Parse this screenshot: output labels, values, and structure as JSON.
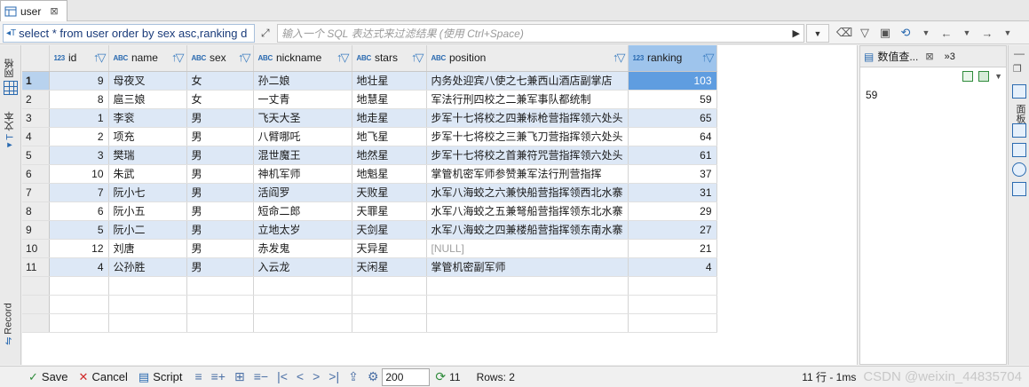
{
  "tab": {
    "title": "user",
    "close": "⊠"
  },
  "query": {
    "text": "select * from user order by sex asc,ranking d",
    "filter_placeholder": "输入一个 SQL 表达式来过滤结果 (使用 Ctrl+Space)"
  },
  "left_strip": {
    "grid_label": "网格",
    "text_label": "文本",
    "record_label": "Record"
  },
  "columns": [
    {
      "type": "123",
      "name": "id"
    },
    {
      "type": "ABC",
      "name": "name"
    },
    {
      "type": "ABC",
      "name": "sex"
    },
    {
      "type": "ABC",
      "name": "nickname"
    },
    {
      "type": "ABC",
      "name": "stars"
    },
    {
      "type": "ABC",
      "name": "position"
    },
    {
      "type": "123",
      "name": "ranking"
    }
  ],
  "rows": [
    {
      "n": "1",
      "id": "9",
      "name": "母夜叉",
      "sex": "女",
      "nickname": "孙二娘",
      "stars": "地壮星",
      "position": "内务处迎宾八使之七兼西山酒店副掌店",
      "ranking": "103"
    },
    {
      "n": "2",
      "id": "8",
      "name": "扈三娘",
      "sex": "女",
      "nickname": "一丈青",
      "stars": "地慧星",
      "position": "军法行刑四校之二兼军事队都统制",
      "ranking": "59"
    },
    {
      "n": "3",
      "id": "1",
      "name": "李衮",
      "sex": "男",
      "nickname": "飞天大圣",
      "stars": "地走星",
      "position": "步军十七将校之四兼标枪营指挥领六处头",
      "ranking": "65"
    },
    {
      "n": "4",
      "id": "2",
      "name": "项充",
      "sex": "男",
      "nickname": "八臂哪吒",
      "stars": "地飞星",
      "position": "步军十七将校之三兼飞刀营指挥领六处头",
      "ranking": "64"
    },
    {
      "n": "5",
      "id": "3",
      "name": "樊瑞",
      "sex": "男",
      "nickname": "混世魔王",
      "stars": "地然星",
      "position": "步军十七将校之首兼符咒营指挥领六处头",
      "ranking": "61"
    },
    {
      "n": "6",
      "id": "10",
      "name": "朱武",
      "sex": "男",
      "nickname": "神机军师",
      "stars": "地魁星",
      "position": "掌管机密军师参赞兼军法行刑营指挥",
      "ranking": "37"
    },
    {
      "n": "7",
      "id": "7",
      "name": "阮小七",
      "sex": "男",
      "nickname": "活阎罗",
      "stars": "天败星",
      "position": "水军八海蛟之六兼快船营指挥领西北水寨",
      "ranking": "31"
    },
    {
      "n": "8",
      "id": "6",
      "name": "阮小五",
      "sex": "男",
      "nickname": "短命二郎",
      "stars": "天罪星",
      "position": "水军八海蛟之五兼弩船营指挥领东北水寨",
      "ranking": "29"
    },
    {
      "n": "9",
      "id": "5",
      "name": "阮小二",
      "sex": "男",
      "nickname": "立地太岁",
      "stars": "天剑星",
      "position": "水军八海蛟之四兼楼船营指挥领东南水寨",
      "ranking": "27"
    },
    {
      "n": "10",
      "id": "12",
      "name": "刘唐",
      "sex": "男",
      "nickname": "赤发鬼",
      "stars": "天异星",
      "position": "[NULL]",
      "ranking": "21"
    },
    {
      "n": "11",
      "id": "4",
      "name": "公孙胜",
      "sex": "男",
      "nickname": "入云龙",
      "stars": "天闲星",
      "position": "掌管机密副军师",
      "ranking": "4"
    }
  ],
  "value_panel": {
    "title": "数值查...",
    "more": "»3",
    "value": "59"
  },
  "right_strip": {
    "label": "面板"
  },
  "bottom": {
    "save": "Save",
    "cancel": "Cancel",
    "script": "Script",
    "limit": "200",
    "count": "11",
    "rows": "Rows: 2",
    "status": "11 行 - 1ms",
    "watermark": "CSDN @weixin_44835704"
  }
}
